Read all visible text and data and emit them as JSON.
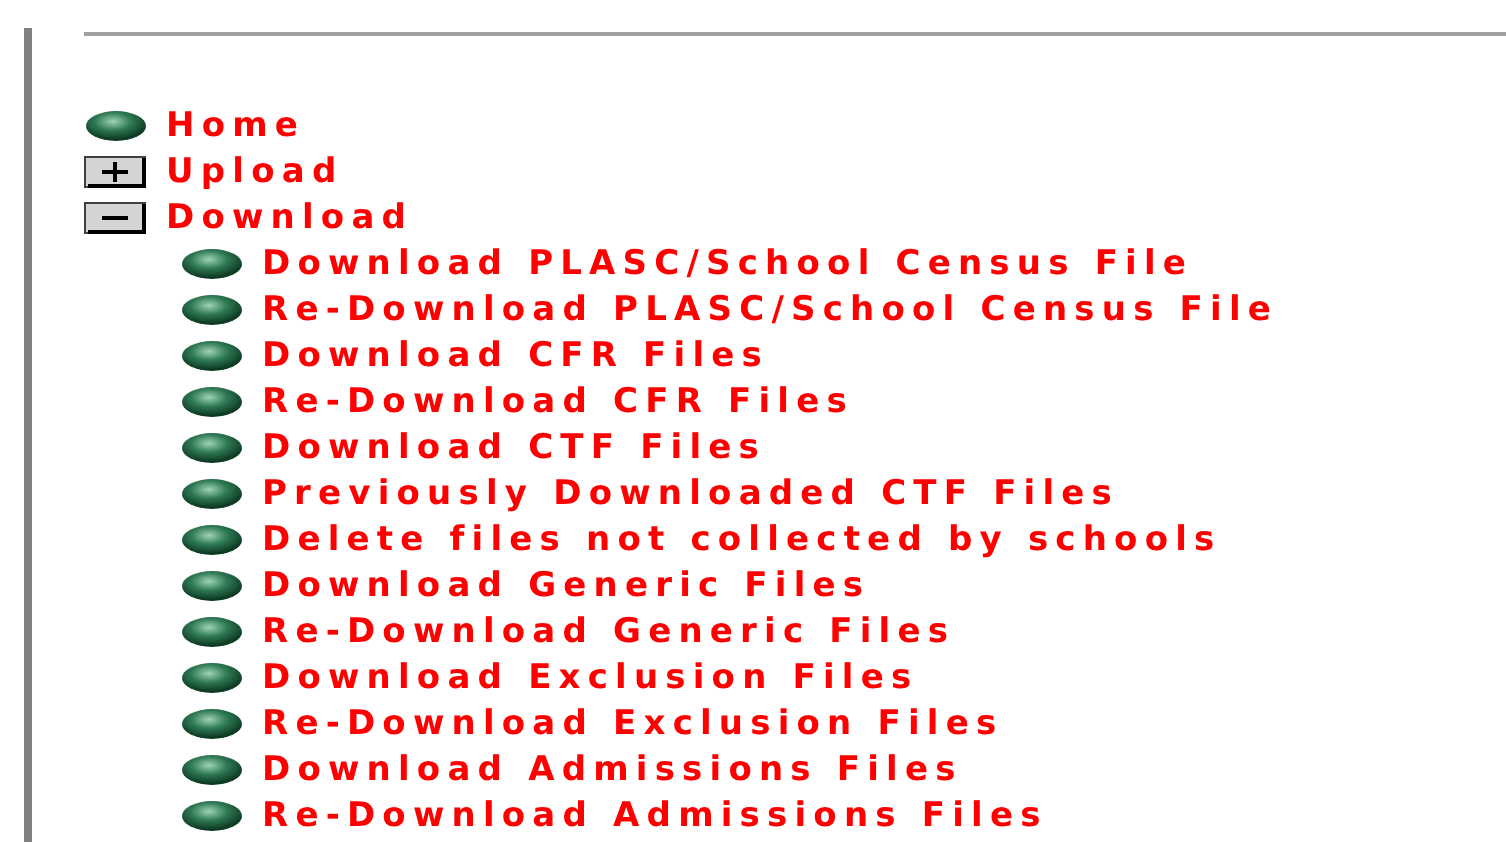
{
  "menu": [
    {
      "label": "Home",
      "kind": "link"
    },
    {
      "label": "Upload",
      "kind": "folder",
      "expanded": false
    },
    {
      "label": "Download",
      "kind": "folder",
      "expanded": true,
      "children": [
        {
          "label": "Download PLASC/School Census File",
          "kind": "link"
        },
        {
          "label": "Re-Download PLASC/School Census File",
          "kind": "link"
        },
        {
          "label": "Download CFR Files",
          "kind": "link"
        },
        {
          "label": "Re-Download CFR Files",
          "kind": "link"
        },
        {
          "label": "Download CTF Files",
          "kind": "link"
        },
        {
          "label": "Previously Downloaded CTF Files",
          "kind": "link"
        },
        {
          "label": "Delete files not collected by schools",
          "kind": "link"
        },
        {
          "label": "Download Generic Files",
          "kind": "link"
        },
        {
          "label": "Re-Download Generic Files",
          "kind": "link"
        },
        {
          "label": "Download Exclusion Files",
          "kind": "link"
        },
        {
          "label": "Re-Download Exclusion Files",
          "kind": "link"
        },
        {
          "label": "Download Admissions Files",
          "kind": "link"
        },
        {
          "label": "Re-Download Admissions Files",
          "kind": "link"
        }
      ]
    }
  ]
}
